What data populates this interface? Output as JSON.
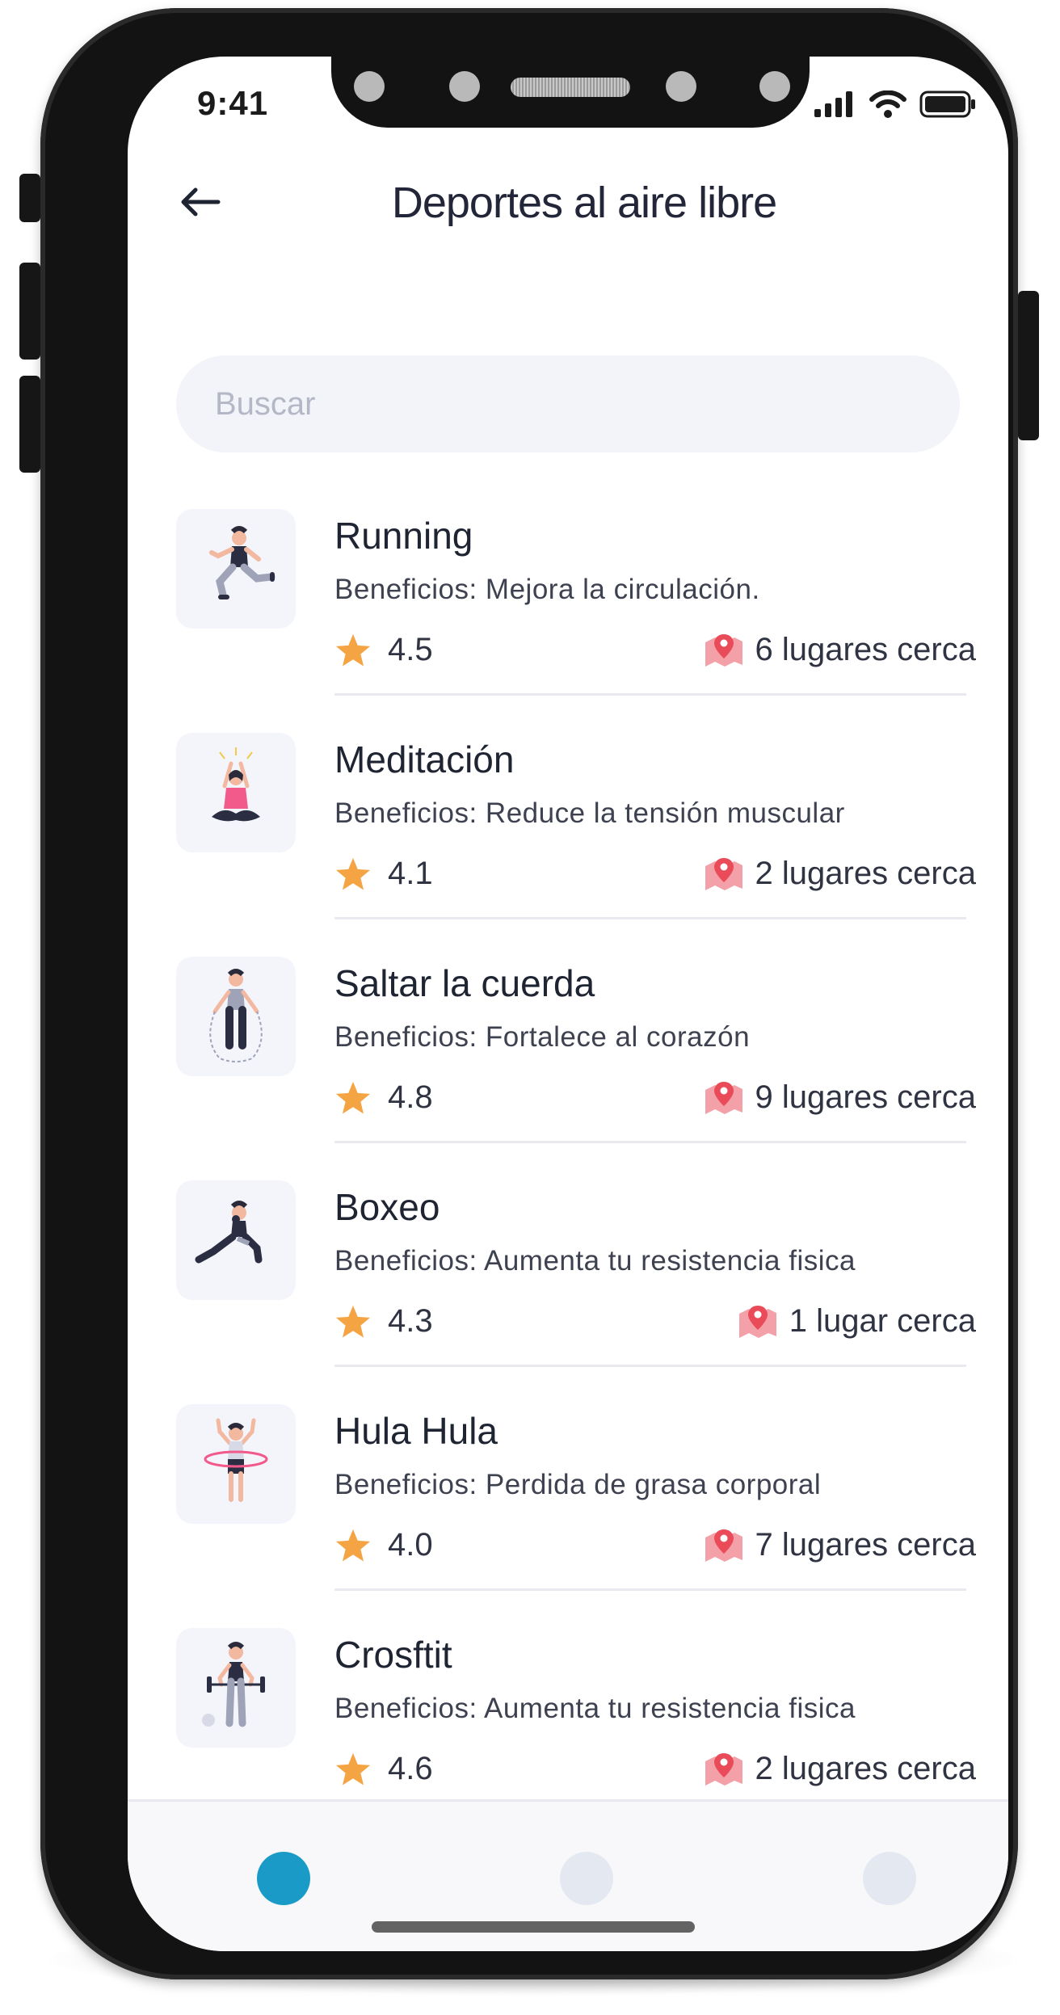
{
  "status_bar": {
    "time": "9:41"
  },
  "header": {
    "title": "Deportes al aire libre",
    "back_icon": "arrow-left-icon"
  },
  "search": {
    "placeholder": "Buscar",
    "value": ""
  },
  "colors": {
    "accent": "#1a9bc7",
    "star": "#f5a443",
    "map_pin": "#e94b59",
    "nav_inactive": "#e4e8f1",
    "thumb_bg": "#f4f5fb"
  },
  "items": [
    {
      "title": "Running",
      "benefit": "Beneficios: Mejora la circulación.",
      "rating": "4.5",
      "places": "6 lugares cerca",
      "illustration": "runner-illustration"
    },
    {
      "title": "Meditación",
      "benefit": "Beneficios: Reduce la tensión muscular",
      "rating": "4.1",
      "places": "2 lugares cerca",
      "illustration": "meditation-illustration"
    },
    {
      "title": "Saltar la cuerda",
      "benefit": "Beneficios: Fortalece al corazón",
      "rating": "4.8",
      "places": "9 lugares cerca",
      "illustration": "jump-rope-illustration"
    },
    {
      "title": "Boxeo",
      "benefit": "Beneficios: Aumenta tu resistencia fisica",
      "rating": "4.3",
      "places": "1 lugar cerca",
      "illustration": "boxing-illustration"
    },
    {
      "title": "Hula Hula",
      "benefit": "Beneficios: Perdida de grasa corporal",
      "rating": "4.0",
      "places": "7 lugares cerca",
      "illustration": "hula-hoop-illustration"
    },
    {
      "title": "Crosftit",
      "benefit": "Beneficios: Aumenta tu resistencia fisica",
      "rating": "4.6",
      "places": "2 lugares cerca",
      "illustration": "crossfit-illustration"
    }
  ],
  "bottom_nav": {
    "items": [
      "nav-tab-1",
      "nav-tab-2",
      "nav-tab-3"
    ],
    "active_index": 0
  }
}
